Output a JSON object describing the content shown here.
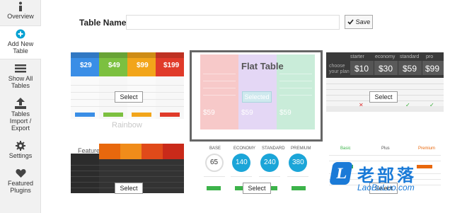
{
  "sidebar": {
    "items": [
      {
        "label": "Overview",
        "icon": "info-icon"
      },
      {
        "label": "Add New Table",
        "icon": "plus-circle-icon"
      },
      {
        "label": "Show All Tables",
        "icon": "list-icon"
      },
      {
        "label": "Tables Import / Export",
        "icon": "upload-icon"
      },
      {
        "label": "Settings",
        "icon": "gear-icon"
      },
      {
        "label": "Featured Plugins",
        "icon": "heart-icon"
      }
    ]
  },
  "header": {
    "table_name_label": "Table Name:",
    "table_name_value": "",
    "save_label": "Save"
  },
  "templates": [
    {
      "caption": "Rainbow",
      "select_label": "Select",
      "prices": [
        "$29",
        "$49",
        "$99",
        "$199"
      ],
      "colors": [
        "#3a8ee6",
        "#7cc040",
        "#f2a51a",
        "#e03b2a"
      ]
    },
    {
      "title": "Flat Table",
      "select_label": "Selected",
      "prices": [
        "$59",
        "$59",
        "$59"
      ],
      "colors": [
        "#f4b8b8",
        "#d9c7f0",
        "#b8e6cf"
      ]
    },
    {
      "select_label": "Select",
      "headers": [
        "starter",
        "economy",
        "standard",
        "pro"
      ],
      "prices": [
        "$10",
        "$30",
        "$59",
        "$99"
      ],
      "side_text": "choose your plan"
    },
    {
      "heading": "Features",
      "select_label": "Select"
    },
    {
      "select_label": "Select",
      "headers": [
        "BASE",
        "ECONOMY",
        "STANDARD",
        "PREMIUM"
      ],
      "prices": [
        "65",
        "140",
        "240",
        "380"
      ]
    },
    {
      "select_label": "Select",
      "headers": [
        "Basic",
        "Plus",
        "Premium"
      ]
    }
  ],
  "watermark": {
    "logo_letter": "L",
    "cn": "老部落",
    "en": "LaoBuLuo.com"
  },
  "colors": {
    "sidebar_bg": "#f1f1f1",
    "accent": "#00a0d2",
    "selected_border": "#666666"
  }
}
